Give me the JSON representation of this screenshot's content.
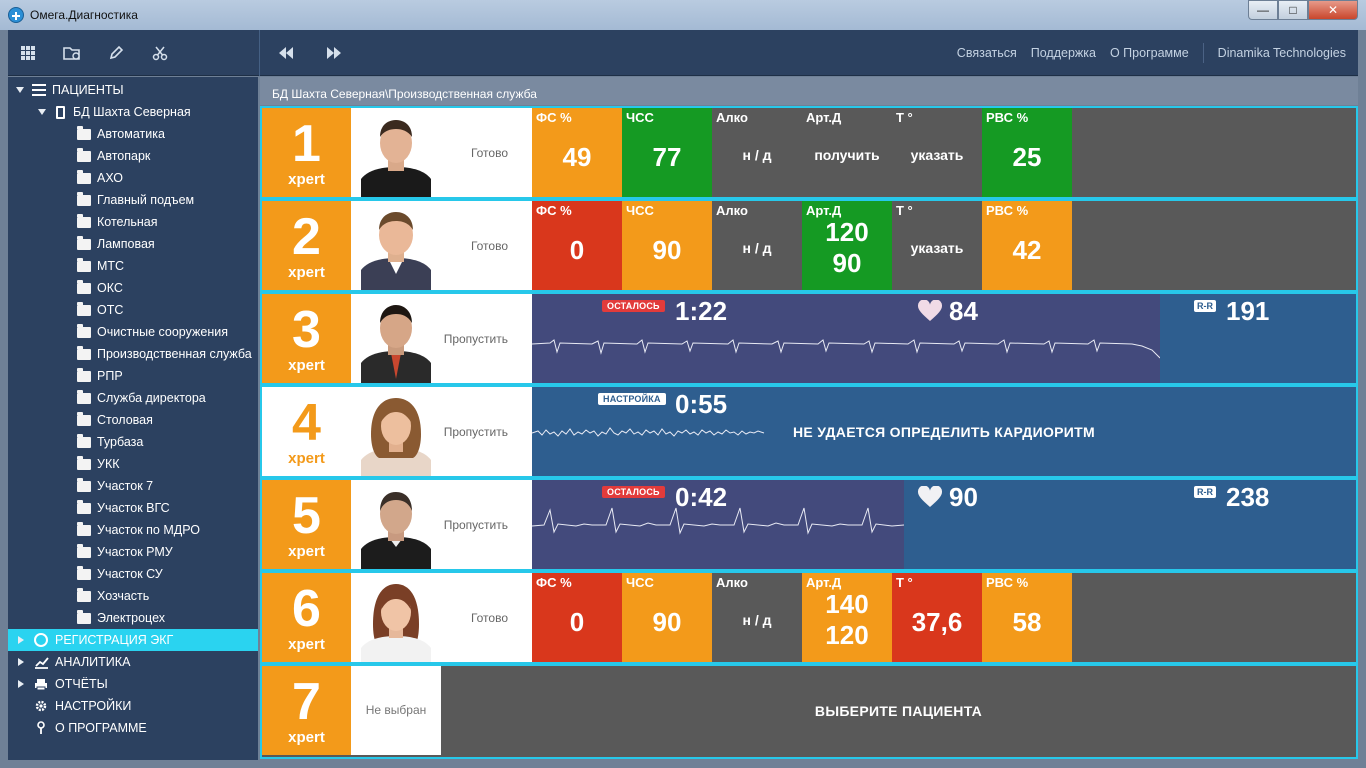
{
  "window": {
    "title": "Омега.Диагностика",
    "min": "—",
    "max": "□",
    "close": "✕"
  },
  "toolbar": {
    "links": [
      "Связаться",
      "Поддержка",
      "О Программе",
      "Dinamika Technologies"
    ]
  },
  "sidebar": {
    "patients_label": "ПАЦИЕНТЫ",
    "db_label": "БД Шахта Северная",
    "folders": [
      "Автоматика",
      "Автопарк",
      "АХО",
      "Главный подъем",
      "Котельная",
      "Ламповая",
      "МТС",
      "ОКС",
      "ОТС",
      "Очистные сооружения",
      "Производственная служба",
      "РПР",
      "Служба директора",
      "Столовая",
      "Турбаза",
      "УКК",
      "Участок 7",
      "Участок ВГС",
      "Участок по МДРО",
      "Участок РМУ",
      "Участок СУ",
      "Хозчасть",
      "Электроцех"
    ],
    "ecg_label": "РЕГИСТРАЦИЯ ЭКГ",
    "analytics_label": "АНАЛИТИКА",
    "reports_label": "ОТЧЁТЫ",
    "settings_label": "НАСТРОЙКИ",
    "about_label": "О ПРОГРАММЕ"
  },
  "breadcrumb": "БД Шахта Северная\\Производственная служба",
  "labels": {
    "fs": "ФС %",
    "hr": "ЧСС",
    "alco": "Алко",
    "bp": "Арт.Д",
    "t": "Т °",
    "rvs": "РВС %"
  },
  "slot_word": "xpert",
  "rows": [
    {
      "num": "1",
      "status": "Готово",
      "fs": "49",
      "hr": "77",
      "alco": "н / д",
      "bp": "получить",
      "t": "указать",
      "rvs": "25"
    },
    {
      "num": "2",
      "status": "Готово",
      "fs": "0",
      "hr": "90",
      "alco": "н / д",
      "bp1": "120",
      "bp2": "90",
      "t": "указать",
      "rvs": "42"
    },
    {
      "num": "3",
      "status": "Пропустить",
      "badge": "ОСТАЛОСЬ",
      "time": "1:22",
      "bpm": "84",
      "rr_label": "R-R",
      "rr": "191"
    },
    {
      "num": "4",
      "status": "Пропустить",
      "badge": "НАСТРОЙКА",
      "time": "0:55",
      "message": "НЕ УДАЕТСЯ ОПРЕДЕЛИТЬ КАРДИОРИТМ"
    },
    {
      "num": "5",
      "status": "Пропустить",
      "badge": "ОСТАЛОСЬ",
      "time": "0:42",
      "bpm": "90",
      "rr_label": "R-R",
      "rr": "238"
    },
    {
      "num": "6",
      "status": "Готово",
      "fs": "0",
      "hr": "90",
      "alco": "н / д",
      "bp1": "140",
      "bp2": "120",
      "t": "37,6",
      "rvs": "58"
    },
    {
      "num": "7",
      "status": "Не выбран",
      "message": "ВЫБЕРИТЕ ПАЦИЕНТА"
    }
  ]
}
